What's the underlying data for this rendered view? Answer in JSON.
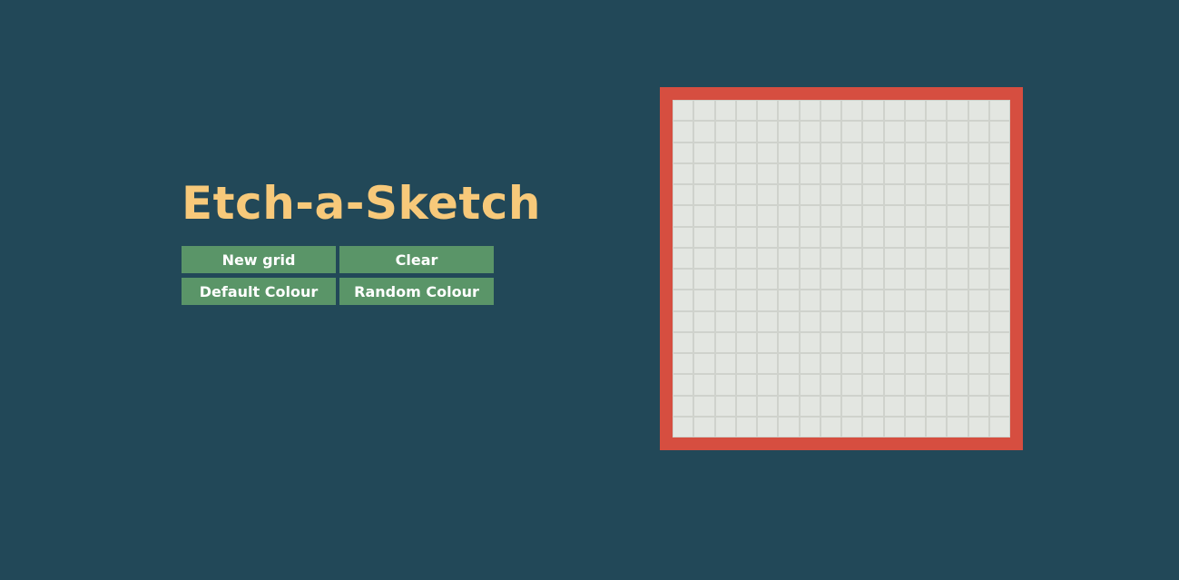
{
  "app": {
    "title": "Etch-a-Sketch"
  },
  "buttons": {
    "new_grid": "New grid",
    "clear": "Clear",
    "default_colour": "Default Colour",
    "random_colour": "Random Colour"
  },
  "sketchpad": {
    "grid_size": 16,
    "colors": {
      "page_background": "#224858",
      "frame": "#d64e40",
      "cell": "#e3e6e1",
      "cell_border": "#cfd2cc",
      "title": "#f7c97a",
      "button": "#5a9568"
    }
  }
}
